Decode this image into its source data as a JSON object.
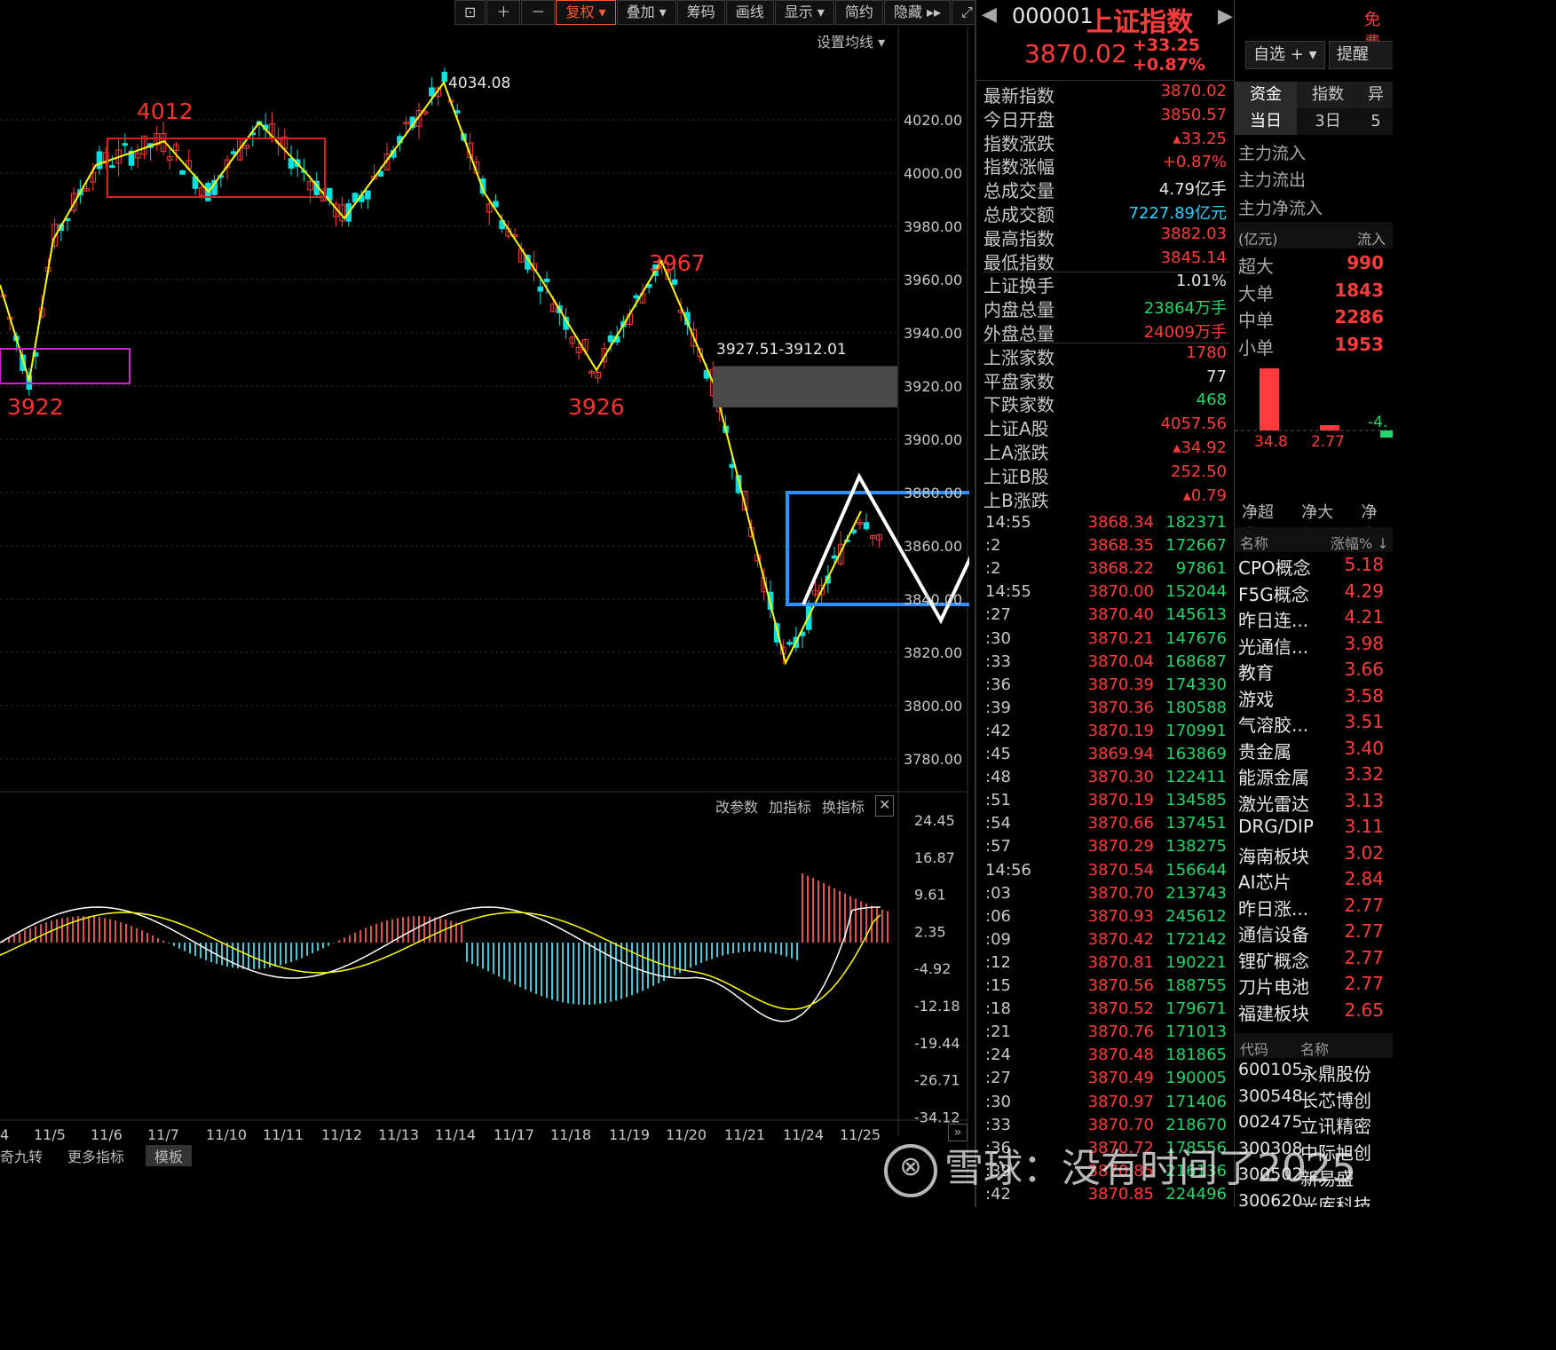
{
  "toolbar": {
    "items": [
      "复权 ▾",
      "叠加 ▾",
      "筹码",
      "画线",
      "显示 ▾",
      "简约",
      "隐藏 ▸▸"
    ],
    "active_index": 0
  },
  "chart": {
    "ma_setting": "设置均线 ▾",
    "price_ticks": [
      "4020.00",
      "4000.00",
      "3980.00",
      "3960.00",
      "3940.00",
      "3920.00",
      "3900.00",
      "3880.00",
      "3860.00",
      "3840.00",
      "3820.00",
      "3800.00",
      "3780.00"
    ],
    "annotations": [
      "4012",
      "3922",
      "3967",
      "3926"
    ],
    "high_marker": "4034.08",
    "gap_label": "3927.51-3912.01",
    "indicator_controls": [
      "改参数",
      "加指标",
      "换指标"
    ],
    "macd_ticks": [
      "24.45",
      "16.87",
      "9.61",
      "2.35",
      "-4.92",
      "-12.18",
      "-19.44",
      "-26.71",
      "-34.12"
    ],
    "date_ticks": [
      "4",
      "11/5",
      "11/6",
      "11/7",
      "11/10",
      "11/11",
      "11/12",
      "11/13",
      "11/14",
      "11/17",
      "11/18",
      "11/19",
      "11/20",
      "11/21",
      "11/24",
      "11/25"
    ],
    "bottom_tabs": [
      "奇九转",
      "更多指标",
      "模板"
    ]
  },
  "quote": {
    "code": "000001",
    "name": "上证指数",
    "price": "3870.02",
    "change": "+33.25",
    "change_pct": "+0.87%",
    "buttons": [
      "自选 + ▾",
      "提醒"
    ],
    "free_label": "免费",
    "fields": [
      {
        "label": "最新指数",
        "value": "3870.02",
        "color": "red"
      },
      {
        "label": "今日开盘",
        "value": "3850.57",
        "color": "red"
      },
      {
        "label": "指数涨跌",
        "value": "▴33.25",
        "color": "red"
      },
      {
        "label": "指数涨幅",
        "value": "+0.87%",
        "color": "red"
      },
      {
        "label": "总成交量",
        "value": "4.79亿手",
        "color": "white"
      },
      {
        "label": "总成交额",
        "value": "7227.89亿元",
        "color": "cyan"
      },
      {
        "label": "最高指数",
        "value": "3882.03",
        "color": "red"
      },
      {
        "label": "最低指数",
        "value": "3845.14",
        "color": "red"
      },
      {
        "label": "上证换手",
        "value": "1.01%",
        "color": "white"
      },
      {
        "label": "内盘总量",
        "value": "23864万手",
        "color": "green"
      },
      {
        "label": "外盘总量",
        "value": "24009万手",
        "color": "red"
      },
      {
        "label": "上涨家数",
        "value": "1780",
        "color": "red"
      },
      {
        "label": "平盘家数",
        "value": "77",
        "color": "white"
      },
      {
        "label": "下跌家数",
        "value": "468",
        "color": "green"
      },
      {
        "label": "上证A股",
        "value": "4057.56",
        "color": "red"
      },
      {
        "label": "上A涨跌",
        "value": "▴34.92",
        "color": "red"
      },
      {
        "label": "上证B股",
        "value": "252.50",
        "color": "red"
      },
      {
        "label": "上B涨跌",
        "value": "▴0.79",
        "color": "red"
      }
    ],
    "ticks": [
      {
        "t": "14:55",
        "p": "3868.34",
        "v": "182371"
      },
      {
        "t": ":2",
        "p": "3868.35",
        "v": "172667"
      },
      {
        "t": ":2",
        "p": "3868.22",
        "v": "97861"
      },
      {
        "t": "14:55",
        "p": "3870.00",
        "v": "152044"
      },
      {
        "t": ":27",
        "p": "3870.40",
        "v": "145613"
      },
      {
        "t": ":30",
        "p": "3870.21",
        "v": "147676"
      },
      {
        "t": ":33",
        "p": "3870.04",
        "v": "168687"
      },
      {
        "t": ":36",
        "p": "3870.39",
        "v": "174330"
      },
      {
        "t": ":39",
        "p": "3870.36",
        "v": "180588"
      },
      {
        "t": ":42",
        "p": "3870.19",
        "v": "170991"
      },
      {
        "t": ":45",
        "p": "3869.94",
        "v": "163869"
      },
      {
        "t": ":48",
        "p": "3870.30",
        "v": "122411"
      },
      {
        "t": ":51",
        "p": "3870.19",
        "v": "134585"
      },
      {
        "t": ":54",
        "p": "3870.66",
        "v": "137451"
      },
      {
        "t": ":57",
        "p": "3870.29",
        "v": "138275"
      },
      {
        "t": "14:56",
        "p": "3870.54",
        "v": "156644"
      },
      {
        "t": ":03",
        "p": "3870.70",
        "v": "213743"
      },
      {
        "t": ":06",
        "p": "3870.93",
        "v": "245612"
      },
      {
        "t": ":09",
        "p": "3870.42",
        "v": "172142"
      },
      {
        "t": ":12",
        "p": "3870.81",
        "v": "190221"
      },
      {
        "t": ":15",
        "p": "3870.56",
        "v": "188755"
      },
      {
        "t": ":18",
        "p": "3870.52",
        "v": "179671"
      },
      {
        "t": ":21",
        "p": "3870.76",
        "v": "171013"
      },
      {
        "t": ":24",
        "p": "3870.48",
        "v": "181865"
      },
      {
        "t": ":27",
        "p": "3870.49",
        "v": "190005"
      },
      {
        "t": ":30",
        "p": "3870.97",
        "v": "171406"
      },
      {
        "t": ":33",
        "p": "3870.70",
        "v": "218670"
      },
      {
        "t": ":36",
        "p": "3870.72",
        "v": "178556"
      },
      {
        "t": ":39",
        "p": "3870.85",
        "v": "216136"
      },
      {
        "t": ":42",
        "p": "3870.85",
        "v": "224496"
      }
    ]
  },
  "side": {
    "tabs": [
      "资金",
      "指数",
      "异"
    ],
    "subtabs": [
      "当日",
      "3日",
      "5"
    ],
    "flows": [
      "主力流入",
      "主力流出",
      "主力净流入"
    ],
    "unit": "(亿元)",
    "inflow_label": "流入",
    "orders": [
      {
        "label": "超大",
        "value": "990"
      },
      {
        "label": "大单",
        "value": "1843"
      },
      {
        "label": "中单",
        "value": "2286"
      },
      {
        "label": "小单",
        "value": "1953"
      }
    ],
    "bar_values": [
      "34.8",
      "2.77",
      "-4."
    ],
    "net_tabs": [
      "净超大",
      "净大单",
      "净中"
    ],
    "sector_header": [
      "名称",
      "涨幅% ↓"
    ],
    "sectors": [
      {
        "name": "CPO概念",
        "chg": "5.18"
      },
      {
        "name": "F5G概念",
        "chg": "4.29"
      },
      {
        "name": "昨日连...",
        "chg": "4.21"
      },
      {
        "name": "光通信...",
        "chg": "3.98"
      },
      {
        "name": "教育",
        "chg": "3.66"
      },
      {
        "name": "游戏",
        "chg": "3.58"
      },
      {
        "name": "气溶胶...",
        "chg": "3.51"
      },
      {
        "name": "贵金属",
        "chg": "3.40"
      },
      {
        "name": "能源金属",
        "chg": "3.32"
      },
      {
        "name": "激光雷达",
        "chg": "3.13"
      },
      {
        "name": "DRG/DIP",
        "chg": "3.11"
      },
      {
        "name": "海南板块",
        "chg": "3.02"
      },
      {
        "name": "AI芯片",
        "chg": "2.84"
      },
      {
        "name": "昨日涨...",
        "chg": "2.77"
      },
      {
        "name": "通信设备",
        "chg": "2.77"
      },
      {
        "name": "锂矿概念",
        "chg": "2.77"
      },
      {
        "name": "刀片电池",
        "chg": "2.77"
      },
      {
        "name": "福建板块",
        "chg": "2.65"
      }
    ],
    "stock_header": [
      "代码",
      "名称"
    ],
    "stocks": [
      {
        "code": "600105",
        "name": "永鼎股份"
      },
      {
        "code": "300548",
        "name": "长芯博创"
      },
      {
        "code": "002475",
        "name": "立讯精密"
      },
      {
        "code": "300308",
        "name": "中际旭创"
      },
      {
        "code": "300502",
        "name": "新易盛"
      },
      {
        "code": "300620",
        "name": "光库科技"
      }
    ]
  },
  "watermark": "雪球：没有时间了2025",
  "colors": {
    "up": "#ff3b3b",
    "down": "#00e0e0",
    "zigzag": "#ffff00",
    "macd_red": "#e05050",
    "macd_cyan": "#3fc8d8"
  }
}
